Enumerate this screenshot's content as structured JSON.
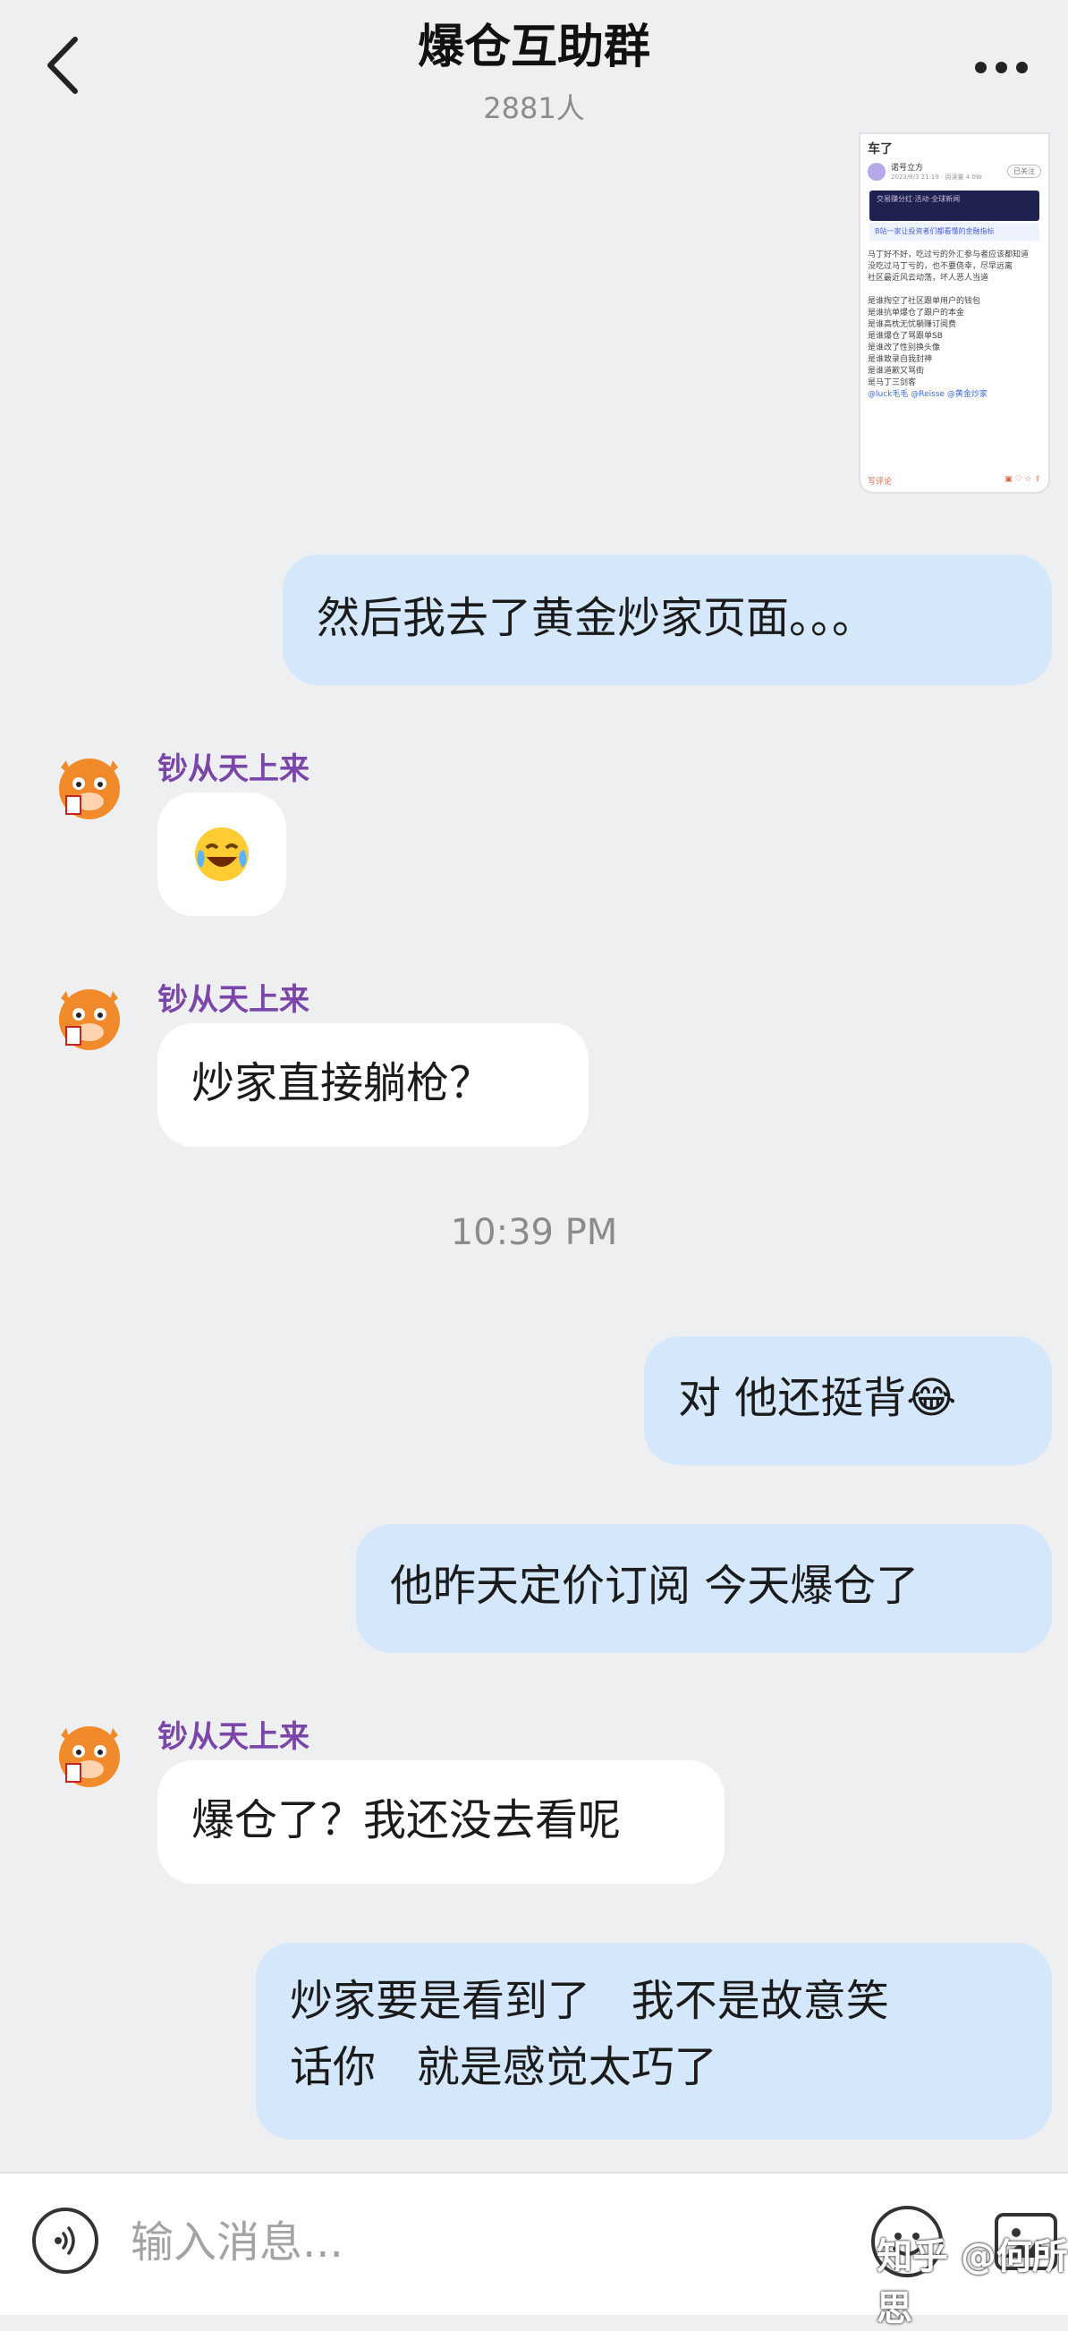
{
  "header": {
    "title": "爆仓互助群",
    "member_count": "2881人"
  },
  "screenshot_thumb": {
    "title": "车了",
    "author": "诺号立方",
    "meta": "2023/8/3 21:19 · 阅读量 4.0W",
    "follow": "已关注",
    "banner": "交易赚分红·活动·全球新闻",
    "link": "B站一家让投资者们都看懂的金融指标",
    "lines": [
      "马丁好不好，吃过亏的外汇参与者应该都知道",
      "没吃过马丁亏的，也不要侥幸，尽早远离",
      "社区最近风云动荡，坏人恶人当道",
      "",
      "是谁掏空了社区跟单用户的钱包",
      "是谁抗单爆仓了跟户的本金",
      "是谁高枕无忧躺赚订阅费",
      "是谁爆仓了骂跟单SB",
      "是谁改了性别换头像",
      "是谁致录自我封神",
      "是谁道歉又骂街",
      "是马丁三剑客"
    ],
    "mentions": "@luck毛毛 @Reisse @黄金炒家",
    "comment_placeholder": "写评论"
  },
  "messages": [
    {
      "side": "out",
      "text": "然后我去了黄金炒家页面。。。"
    },
    {
      "side": "in",
      "sender": "钞从天上来",
      "text": "😂"
    },
    {
      "side": "in",
      "sender": "钞从天上来",
      "text": "炒家直接躺枪？"
    },
    {
      "side": "out",
      "text": "对  他还挺背😂"
    },
    {
      "side": "out",
      "text": "他昨天定价订阅  今天爆仓了"
    },
    {
      "side": "in",
      "sender": "钞从天上来",
      "text": "爆仓了？我还没去看呢"
    },
    {
      "side": "out",
      "line1": "炒家要是看到了   我不是故意笑",
      "line2": "话你   就是感觉太巧了"
    }
  ],
  "timestamp": "10:39 PM",
  "input_bar": {
    "placeholder": "输入消息..."
  },
  "watermark": "知乎 @何所思",
  "colors": {
    "background": "#eeeff1",
    "outgoing_bubble": "#d4e7fb",
    "incoming_bubble": "#ffffff",
    "sender_name": "#7a46a7"
  }
}
